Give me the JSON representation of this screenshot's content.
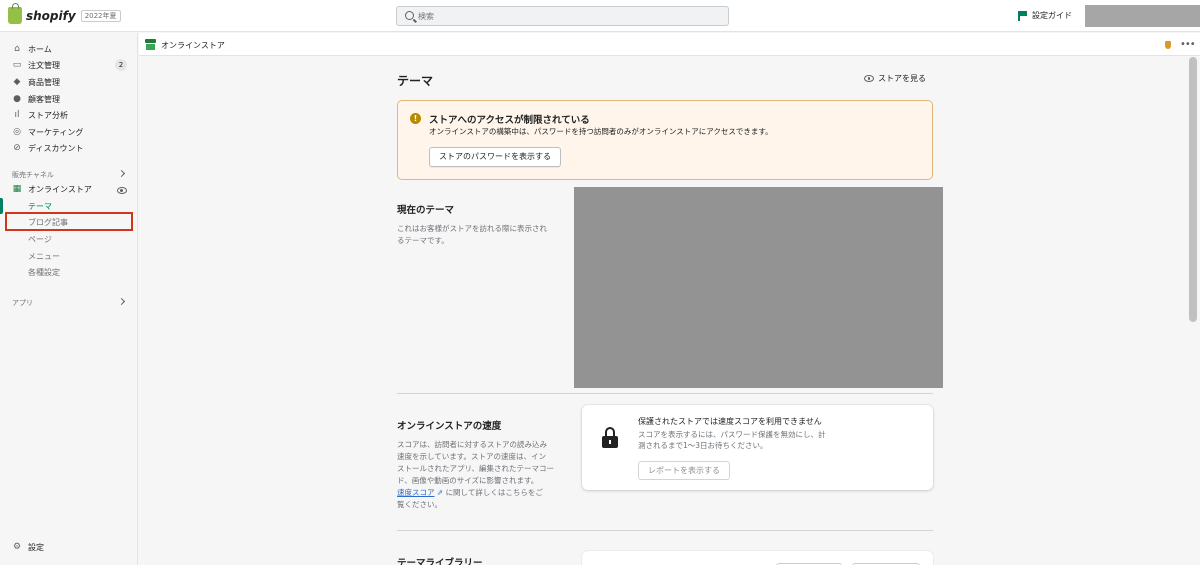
{
  "app": {
    "brand": "shopify",
    "edition": "2022年夏"
  },
  "topbar": {
    "search_placeholder": "検索",
    "setup_guide": "設定ガイド"
  },
  "sidebar": {
    "items": [
      {
        "label": "ホーム",
        "icon": "home-icon"
      },
      {
        "label": "注文管理",
        "icon": "inbox-icon",
        "badge": "2"
      },
      {
        "label": "商品管理",
        "icon": "tag-icon"
      },
      {
        "label": "顧客管理",
        "icon": "person-icon"
      },
      {
        "label": "ストア分析",
        "icon": "bar-chart-icon"
      },
      {
        "label": "マーケティング",
        "icon": "target-icon"
      },
      {
        "label": "ディスカウント",
        "icon": "discount-icon"
      }
    ],
    "sales_channels_label": "販売チャネル",
    "online_store_label": "オンラインストア",
    "sub_items": [
      "テーマ",
      "ブログ記事",
      "ページ",
      "メニュー",
      "各種設定"
    ],
    "apps_label": "アプリ",
    "settings_label": "設定"
  },
  "channel_header": {
    "title": "オンラインストア"
  },
  "main": {
    "title": "テーマ",
    "view_store": "ストアを見る",
    "banner": {
      "title": "ストアへのアクセスが制限されている",
      "body": "オンラインストアの構築中は、パスワードを持つ訪問者のみがオンラインストアにアクセスできます。",
      "button": "ストアのパスワードを表示する"
    },
    "current_theme": {
      "heading": "現在のテーマ",
      "desc_line1": "これはお客様がストアを訪れる際に表示され",
      "desc_line2": "るテーマです。"
    },
    "speed": {
      "heading": "オンラインストアの速度",
      "desc_line1": "スコアは、訪問者に対するストアの読み込み",
      "desc_line2": "速度を示しています。ストアの速度は、イン",
      "desc_line3": "ストールされたアプリ、編集されたテーマコー",
      "desc_line4": "ド、画像や動画のサイズに影響されます。",
      "link": "速度スコア",
      "desc_line5_tail": "に関して詳しくはこちらをご",
      "desc_line6": "覧ください。",
      "card_title": "保護されたストアでは速度スコアを利用できません",
      "card_body_line1": "スコアを表示するには、パスワード保護を無効にし、計",
      "card_body_line2": "測されるまで1〜3日お待ちください。",
      "report_button": "レポートを表示する"
    },
    "library": {
      "heading": "テーマライブラリー"
    }
  },
  "colors": {
    "accent": "#008060",
    "highlight": "#d0361c",
    "warning_bg": "#fff5ea"
  }
}
